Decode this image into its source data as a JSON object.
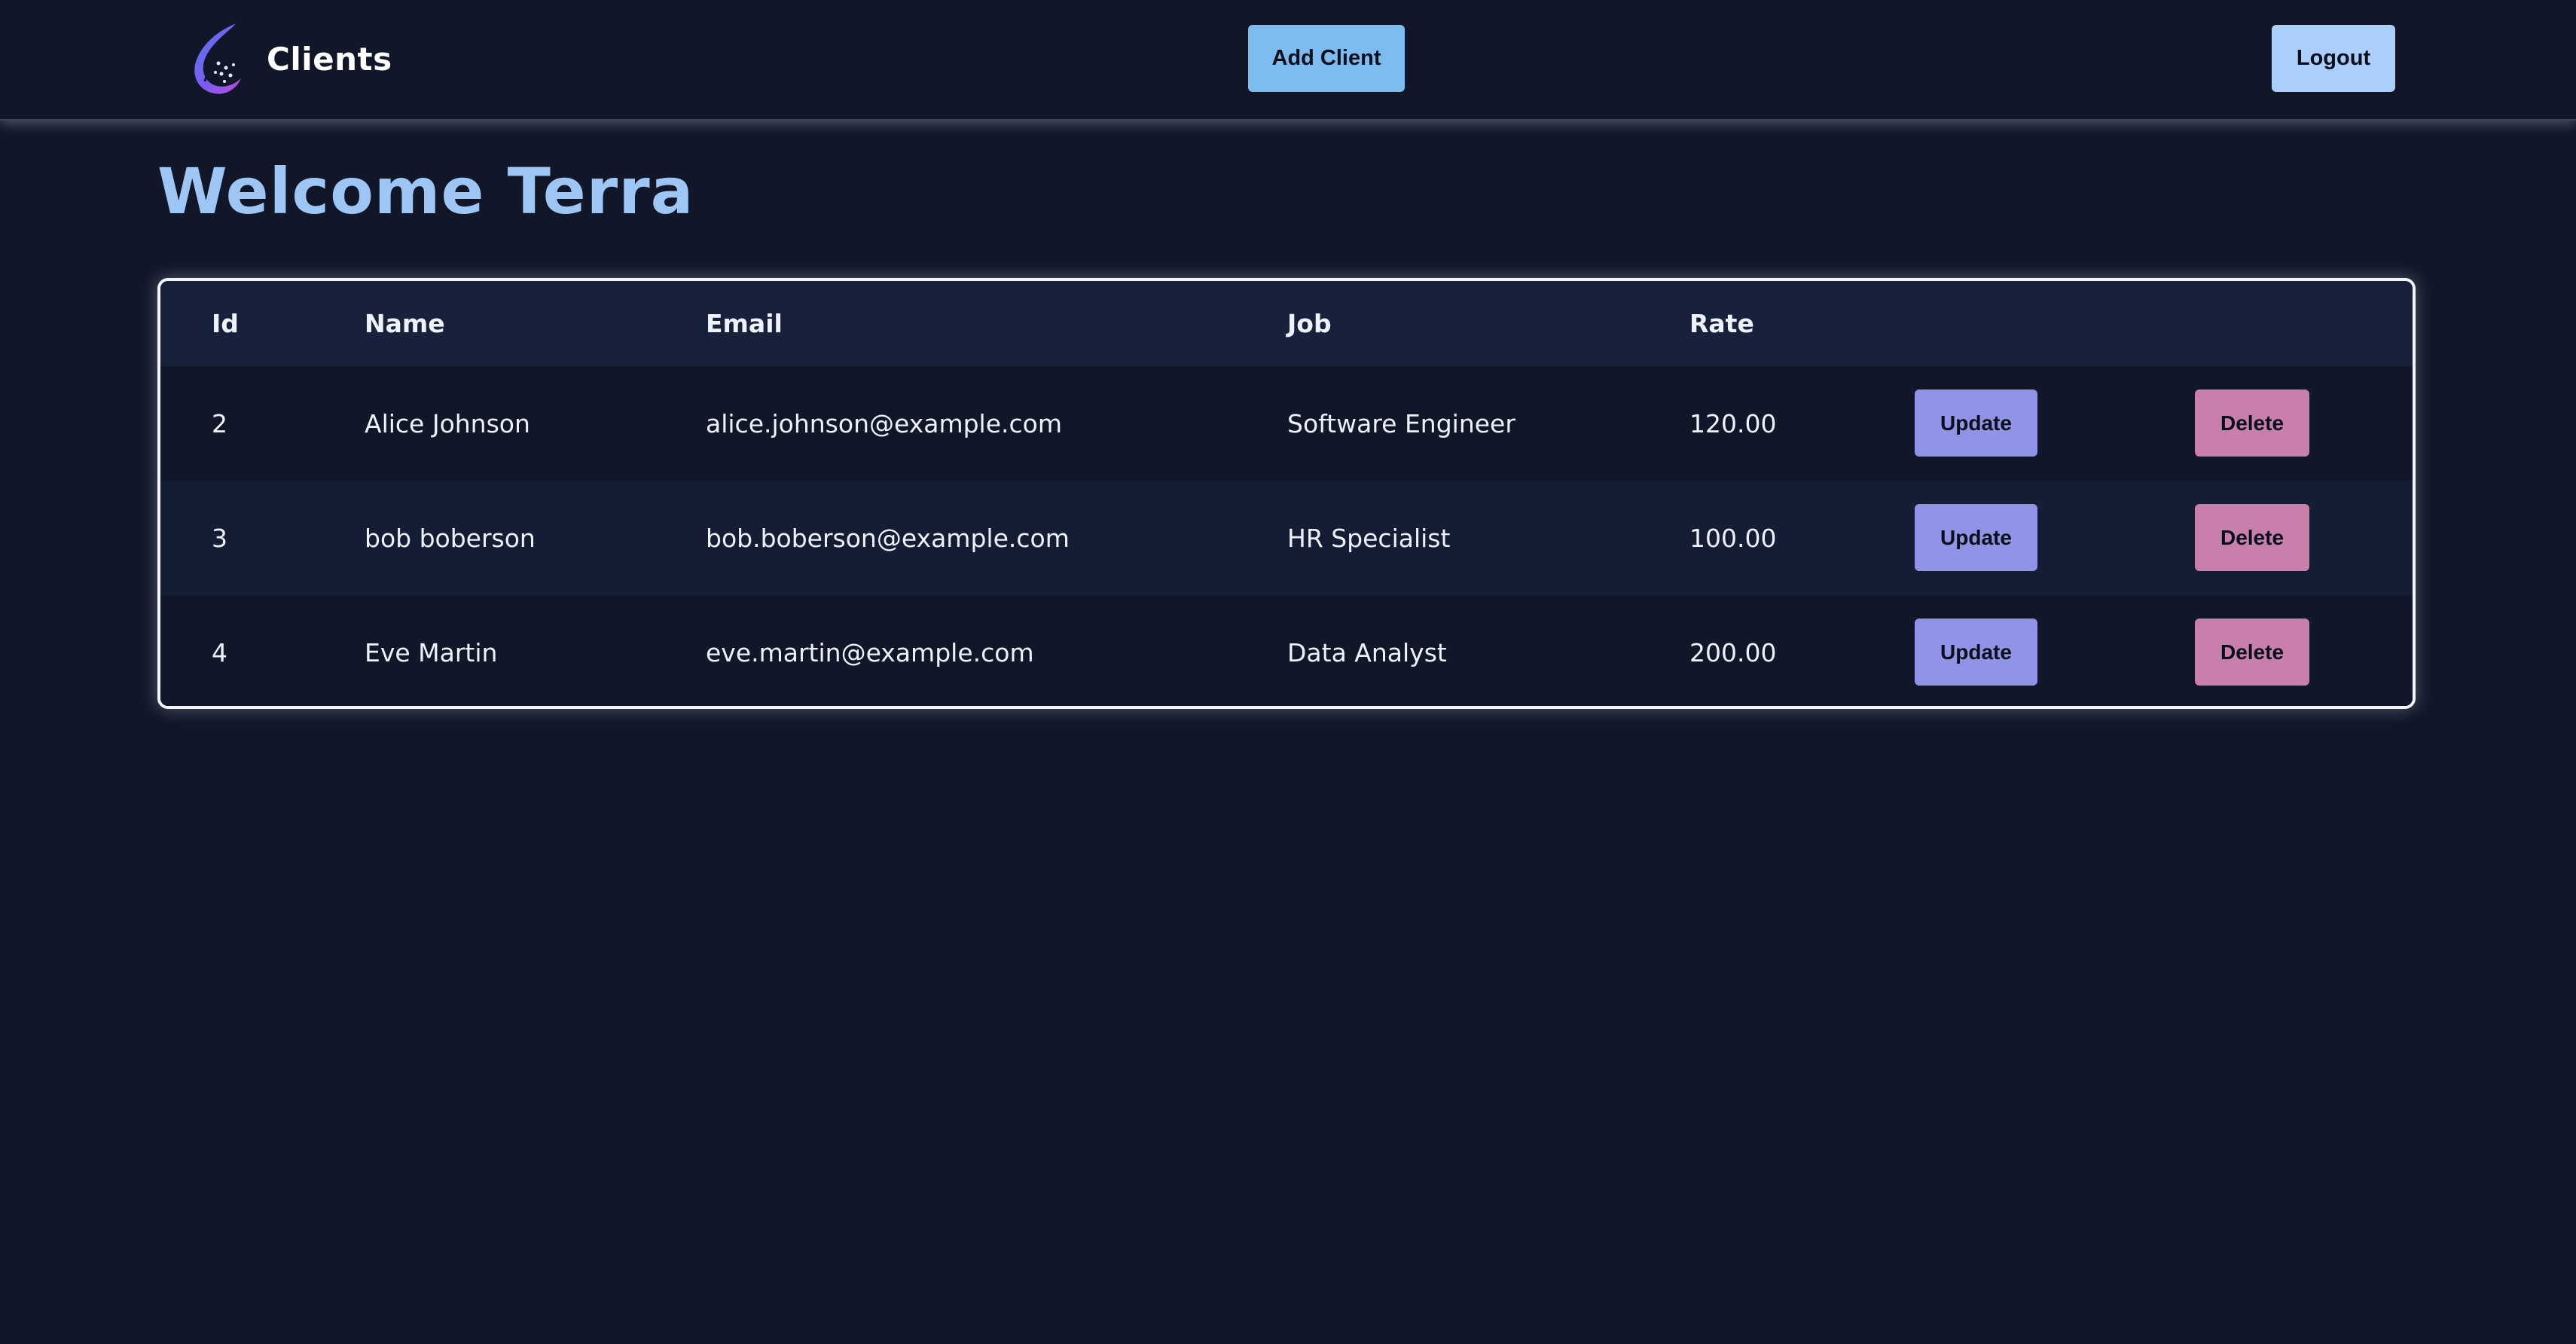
{
  "navbar": {
    "title": "Clients",
    "logo_icon": "feather-quill-logo-icon",
    "add_client_label": "Add Client",
    "logout_label": "Logout"
  },
  "main": {
    "welcome_text": "Welcome Terra"
  },
  "table": {
    "headers": {
      "id": "Id",
      "name": "Name",
      "email": "Email",
      "job": "Job",
      "rate": "Rate"
    },
    "rows": [
      {
        "id": "2",
        "name": "Alice Johnson",
        "email": "alice.johnson@example.com",
        "job": "Software Engineer",
        "rate": "120.00",
        "update_label": "Update",
        "delete_label": "Delete"
      },
      {
        "id": "3",
        "name": "bob boberson",
        "email": "bob.boberson@example.com",
        "job": "HR Specialist",
        "rate": "100.00",
        "update_label": "Update",
        "delete_label": "Delete"
      },
      {
        "id": "4",
        "name": "Eve Martin",
        "email": "eve.martin@example.com",
        "job": "Data Analyst",
        "rate": "200.00",
        "update_label": "Update",
        "delete_label": "Delete"
      }
    ]
  },
  "colors": {
    "background": "#111729",
    "heading": "#9ec6f5",
    "add_button": "#7cbcf0",
    "logout_button": "#a9cffa",
    "update_button": "#8f94e6",
    "delete_button": "#c87fab"
  }
}
